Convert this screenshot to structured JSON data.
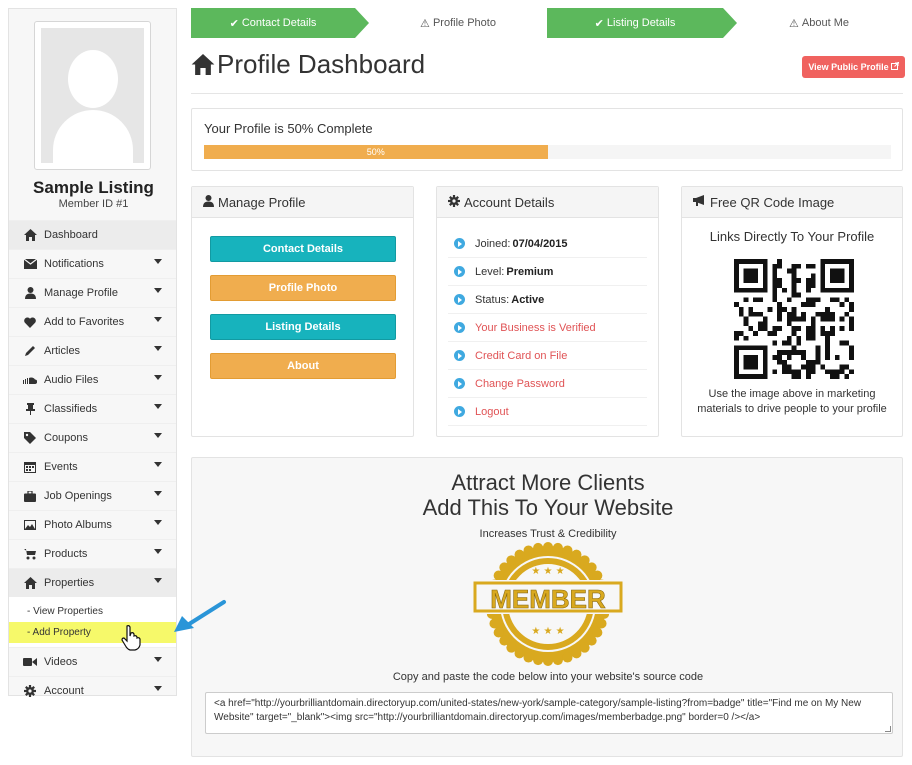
{
  "wizard": {
    "steps": [
      {
        "label": "Contact Details",
        "status": "complete",
        "icon": "check-icon"
      },
      {
        "label": "Profile Photo",
        "status": "incomplete",
        "icon": "warning-icon"
      },
      {
        "label": "Listing Details",
        "status": "complete",
        "icon": "check-icon"
      },
      {
        "label": "About Me",
        "status": "incomplete",
        "icon": "warning-icon"
      }
    ],
    "complete_color": "#5cb85c"
  },
  "sidebar": {
    "listing_name": "Sample Listing",
    "member_id": "Member ID #1",
    "items": [
      {
        "label": "Dashboard",
        "icon": "home-icon",
        "active": true
      },
      {
        "label": "Notifications",
        "icon": "envelope-icon"
      },
      {
        "label": "Manage Profile",
        "icon": "user-icon"
      },
      {
        "label": "Add to Favorites",
        "icon": "heart-icon"
      },
      {
        "label": "Articles",
        "icon": "pencil-icon"
      },
      {
        "label": "Audio Files",
        "icon": "soundcloud-icon"
      },
      {
        "label": "Classifieds",
        "icon": "pushpin-icon"
      },
      {
        "label": "Coupons",
        "icon": "tag-icon"
      },
      {
        "label": "Events",
        "icon": "calendar-icon"
      },
      {
        "label": "Job Openings",
        "icon": "briefcase-icon"
      },
      {
        "label": "Photo Albums",
        "icon": "image-icon"
      },
      {
        "label": "Products",
        "icon": "cart-icon"
      },
      {
        "label": "Properties",
        "icon": "home-icon",
        "expanded": true
      },
      {
        "label": "Videos",
        "icon": "video-icon"
      },
      {
        "label": "Account",
        "icon": "gear-icon"
      }
    ],
    "properties_sub": [
      {
        "label": "- View Properties"
      },
      {
        "label": "- Add Property",
        "highlighted": true
      }
    ]
  },
  "header": {
    "title": "Profile Dashboard",
    "public_button": "View Public Profile"
  },
  "progress": {
    "label": "Your Profile is 50% Complete",
    "value": 0.5,
    "bar_text": "50%",
    "color": "#f0ad4e"
  },
  "manage_profile": {
    "title": "Manage Profile",
    "buttons": [
      {
        "label": "Contact Details",
        "color": "#17b3bd"
      },
      {
        "label": "Profile Photo",
        "color": "#f0ad4e"
      },
      {
        "label": "Listing Details",
        "color": "#17b3bd"
      },
      {
        "label": "About",
        "color": "#f0ad4e"
      }
    ]
  },
  "account_details": {
    "title": "Account Details",
    "joined_label": "Joined:",
    "joined_value": "07/04/2015",
    "level_label": "Level:",
    "level_value": "Premium",
    "status_label": "Status:",
    "status_value": "Active",
    "links": [
      "Your Business is Verified",
      "Credit Card on File",
      "Change Password",
      "Logout"
    ],
    "link_color": "#e05355"
  },
  "qr": {
    "title": "Free QR Code Image",
    "subtitle": "Links Directly To Your Profile",
    "caption": "Use the image above in marketing materials to drive people to your profile"
  },
  "attract": {
    "line1": "Attract More Clients",
    "line2": "Add This To Your Website",
    "sub": "Increases Trust & Credibility",
    "badge_text": "MEMBER",
    "copy_text": "Copy and paste the code below into your website's source code",
    "code": "<a href=\"http://yourbrilliantdomain.directoryup.com/united-states/new-york/sample-category/sample-listing?from=badge\" title=\"Find me on My New Website\" target=\"_blank\"><img src=\"http://yourbrilliantdomain.directoryup.com/images/memberbadge.png\" border=0 /></a>"
  }
}
